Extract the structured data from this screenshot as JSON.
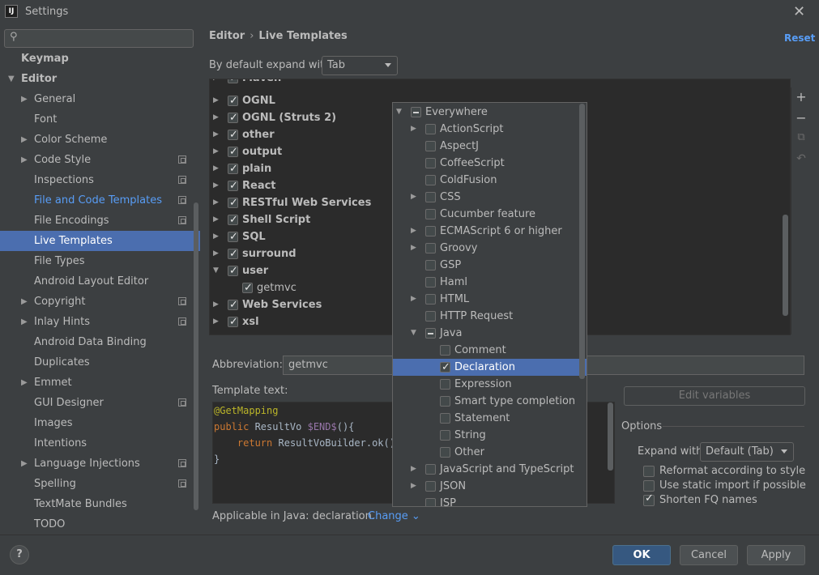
{
  "window": {
    "title": "Settings",
    "app_icon_text": "IJ"
  },
  "sidebar": {
    "search_placeholder": "",
    "items": [
      {
        "label": "Keymap",
        "indent": 0,
        "arrow": "",
        "bold": true
      },
      {
        "label": "Editor",
        "indent": 0,
        "arrow": "▼",
        "bold": true
      },
      {
        "label": "General",
        "indent": 1,
        "arrow": "▶"
      },
      {
        "label": "Font",
        "indent": 1,
        "arrow": ""
      },
      {
        "label": "Color Scheme",
        "indent": 1,
        "arrow": "▶"
      },
      {
        "label": "Code Style",
        "indent": 1,
        "arrow": "▶",
        "project": true
      },
      {
        "label": "Inspections",
        "indent": 1,
        "arrow": "",
        "project": true
      },
      {
        "label": "File and Code Templates",
        "indent": 1,
        "arrow": "",
        "project": true,
        "link": true
      },
      {
        "label": "File Encodings",
        "indent": 1,
        "arrow": "",
        "project": true
      },
      {
        "label": "Live Templates",
        "indent": 1,
        "arrow": "",
        "selected": true
      },
      {
        "label": "File Types",
        "indent": 1,
        "arrow": ""
      },
      {
        "label": "Android Layout Editor",
        "indent": 1,
        "arrow": ""
      },
      {
        "label": "Copyright",
        "indent": 1,
        "arrow": "▶",
        "project": true
      },
      {
        "label": "Inlay Hints",
        "indent": 1,
        "arrow": "▶",
        "project": true
      },
      {
        "label": "Android Data Binding",
        "indent": 1,
        "arrow": ""
      },
      {
        "label": "Duplicates",
        "indent": 1,
        "arrow": ""
      },
      {
        "label": "Emmet",
        "indent": 1,
        "arrow": "▶"
      },
      {
        "label": "GUI Designer",
        "indent": 1,
        "arrow": "",
        "project": true
      },
      {
        "label": "Images",
        "indent": 1,
        "arrow": ""
      },
      {
        "label": "Intentions",
        "indent": 1,
        "arrow": ""
      },
      {
        "label": "Language Injections",
        "indent": 1,
        "arrow": "▶",
        "project": true
      },
      {
        "label": "Spelling",
        "indent": 1,
        "arrow": "",
        "project": true
      },
      {
        "label": "TextMate Bundles",
        "indent": 1,
        "arrow": ""
      },
      {
        "label": "TODO",
        "indent": 1,
        "arrow": ""
      }
    ]
  },
  "header": {
    "breadcrumb_parent": "Editor",
    "breadcrumb_sep": "›",
    "breadcrumb_current": "Live Templates",
    "reset_label": "Reset"
  },
  "expand": {
    "label": "By default expand with",
    "value": "Tab"
  },
  "templates": [
    {
      "label": "Maven",
      "arrow": "▶",
      "checked": true,
      "bold": true,
      "level": 0
    },
    {
      "label": "OGNL",
      "arrow": "▶",
      "checked": true,
      "bold": true,
      "level": 0
    },
    {
      "label": "OGNL (Struts 2)",
      "arrow": "▶",
      "checked": true,
      "bold": true,
      "level": 0
    },
    {
      "label": "other",
      "arrow": "▶",
      "checked": true,
      "bold": true,
      "level": 0
    },
    {
      "label": "output",
      "arrow": "▶",
      "checked": true,
      "bold": true,
      "level": 0
    },
    {
      "label": "plain",
      "arrow": "▶",
      "checked": true,
      "bold": true,
      "level": 0
    },
    {
      "label": "React",
      "arrow": "▶",
      "checked": true,
      "bold": true,
      "level": 0
    },
    {
      "label": "RESTful Web Services",
      "arrow": "▶",
      "checked": true,
      "bold": true,
      "level": 0
    },
    {
      "label": "Shell Script",
      "arrow": "▶",
      "checked": true,
      "bold": true,
      "level": 0
    },
    {
      "label": "SQL",
      "arrow": "▶",
      "checked": true,
      "bold": true,
      "level": 0
    },
    {
      "label": "surround",
      "arrow": "▶",
      "checked": true,
      "bold": true,
      "level": 0
    },
    {
      "label": "user",
      "arrow": "▼",
      "checked": true,
      "bold": true,
      "level": 0
    },
    {
      "label": "getmvc",
      "arrow": "",
      "checked": true,
      "bold": false,
      "level": 1,
      "selected": true
    },
    {
      "label": "Web Services",
      "arrow": "▶",
      "checked": true,
      "bold": true,
      "level": 0
    },
    {
      "label": "xsl",
      "arrow": "▶",
      "checked": true,
      "bold": true,
      "level": 0
    }
  ],
  "toolbar": {
    "add_icon": "+",
    "remove_icon": "−",
    "copy_icon": "⧉",
    "restore_icon": "↶"
  },
  "abbreviation": {
    "label": "Abbreviation:",
    "value": "getmvc"
  },
  "template_text": {
    "label": "Template text:",
    "lines": {
      "l1": "@GetMapping",
      "l2_kw": "public",
      "l2_mid": " ResultVo ",
      "l2_var": "$END$",
      "l2_end": "(){",
      "l3_indent": "    ",
      "l3_kw": "return",
      "l3_rest": " ResultVoBuilder.ok();",
      "l4": "}"
    }
  },
  "applicable": {
    "text": "Applicable in Java: declaration.",
    "change_label": "Change ⌄"
  },
  "edit_variables_label": "Edit variables",
  "options": {
    "title": "Options",
    "expand_label": "Expand with",
    "expand_value": "Default (Tab)",
    "reformat_label": "Reformat according to style",
    "reformat_checked": false,
    "static_import_label": "Use static import if possible",
    "static_import_checked": false,
    "shorten_label": "Shorten FQ names",
    "shorten_checked": true
  },
  "contexts": [
    {
      "label": "Everywhere",
      "arrow": "▼",
      "state": "partial",
      "level": 0
    },
    {
      "label": "ActionScript",
      "arrow": "▶",
      "state": "unchecked",
      "level": 1
    },
    {
      "label": "AspectJ",
      "arrow": "",
      "state": "unchecked",
      "level": 1
    },
    {
      "label": "CoffeeScript",
      "arrow": "",
      "state": "unchecked",
      "level": 1
    },
    {
      "label": "ColdFusion",
      "arrow": "",
      "state": "unchecked",
      "level": 1
    },
    {
      "label": "CSS",
      "arrow": "▶",
      "state": "unchecked",
      "level": 1
    },
    {
      "label": "Cucumber feature",
      "arrow": "",
      "state": "unchecked",
      "level": 1
    },
    {
      "label": "ECMAScript 6 or higher",
      "arrow": "▶",
      "state": "unchecked",
      "level": 1
    },
    {
      "label": "Groovy",
      "arrow": "▶",
      "state": "unchecked",
      "level": 1
    },
    {
      "label": "GSP",
      "arrow": "",
      "state": "unchecked",
      "level": 1
    },
    {
      "label": "Haml",
      "arrow": "",
      "state": "unchecked",
      "level": 1
    },
    {
      "label": "HTML",
      "arrow": "▶",
      "state": "unchecked",
      "level": 1
    },
    {
      "label": "HTTP Request",
      "arrow": "",
      "state": "unchecked",
      "level": 1
    },
    {
      "label": "Java",
      "arrow": "▼",
      "state": "partial",
      "level": 1
    },
    {
      "label": "Comment",
      "arrow": "",
      "state": "unchecked",
      "level": 2
    },
    {
      "label": "Declaration",
      "arrow": "",
      "state": "checked",
      "level": 2,
      "selected": true
    },
    {
      "label": "Expression",
      "arrow": "",
      "state": "unchecked",
      "level": 2
    },
    {
      "label": "Smart type completion",
      "arrow": "",
      "state": "unchecked",
      "level": 2
    },
    {
      "label": "Statement",
      "arrow": "",
      "state": "unchecked",
      "level": 2
    },
    {
      "label": "String",
      "arrow": "",
      "state": "unchecked",
      "level": 2
    },
    {
      "label": "Other",
      "arrow": "",
      "state": "unchecked",
      "level": 2
    },
    {
      "label": "JavaScript and TypeScript",
      "arrow": "▶",
      "state": "unchecked",
      "level": 1
    },
    {
      "label": "JSON",
      "arrow": "▶",
      "state": "unchecked",
      "level": 1
    },
    {
      "label": "JSP",
      "arrow": "",
      "state": "unchecked",
      "level": 1
    }
  ],
  "footer": {
    "help_label": "?",
    "ok_label": "OK",
    "cancel_label": "Cancel",
    "apply_label": "Apply"
  },
  "colors": {
    "accent": "#4b6eaf",
    "link": "#589df6",
    "background": "#3c3f41",
    "editor_bg": "#2b2b2b"
  }
}
